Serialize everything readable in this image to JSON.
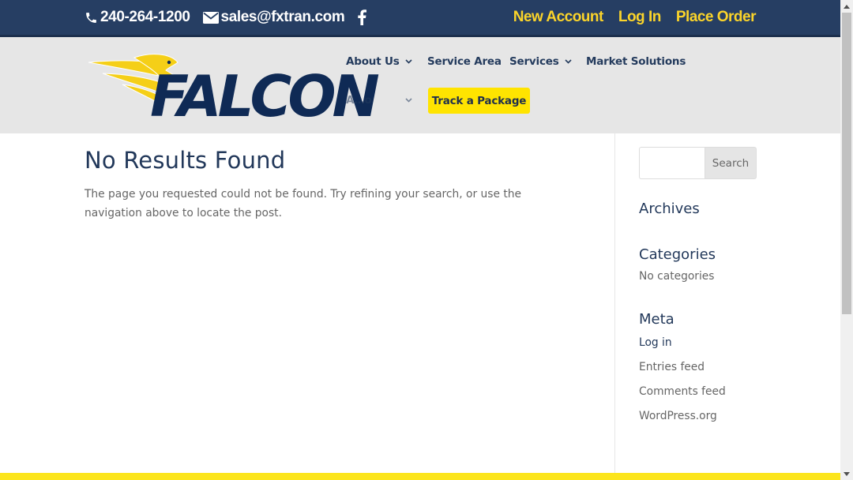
{
  "topbar": {
    "phone": "240-264-1200",
    "email": "sales@fxtran.com",
    "facebook_icon": "facebook-icon",
    "links": [
      "New Account",
      "Log In",
      "Place Order"
    ]
  },
  "logo": {
    "text": "FALCON"
  },
  "nav": {
    "about": "About Us",
    "service_area": "Service Area",
    "services": "Services",
    "market": "Market Solutions",
    "hidden_item": "A…o",
    "track": "Track a Package"
  },
  "main": {
    "title": "No Results Found",
    "message": "The page you requested could not be found. Try refining your search, or use the navigation above to locate the post."
  },
  "sidebar": {
    "search_button": "Search",
    "archives_title": "Archives",
    "categories_title": "Categories",
    "categories_empty": "No categories",
    "meta_title": "Meta",
    "meta_links": [
      "Log in",
      "Entries feed",
      "Comments feed",
      "WordPress.org"
    ]
  },
  "colors": {
    "navy": "#263e63",
    "yellow": "#fbd42a",
    "button_yellow": "#ffe400",
    "header_gray": "#e6e6e6"
  }
}
